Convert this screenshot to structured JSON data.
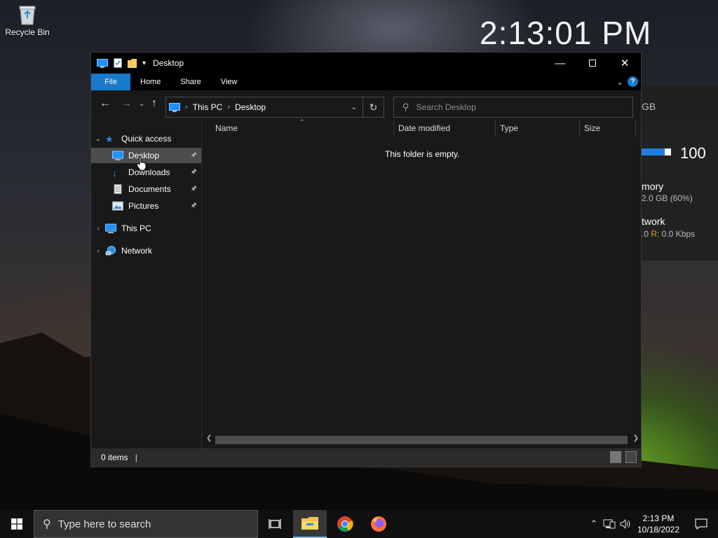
{
  "desktop": {
    "recycle_bin_label": "Recycle Bin"
  },
  "widget": {
    "clock": "2:13:01 PM",
    "disk_unit": "GB",
    "cpu_value": "100",
    "memory_title": "mory",
    "memory_value": "2.0 GB (60%)",
    "network_title": "twork",
    "network_value_prefix": ".0 ",
    "network_r_label": "R:",
    "network_value_suffix": " 0.0 Kbps"
  },
  "explorer": {
    "title": "Desktop",
    "ribbon_tabs": [
      "File",
      "Home",
      "Share",
      "View"
    ],
    "help_label": "?",
    "address": {
      "root": "This PC",
      "current": "Desktop"
    },
    "search_placeholder": "Search Desktop",
    "sidebar": {
      "quick_access": "Quick access",
      "items": [
        "Desktop",
        "Downloads",
        "Documents",
        "Pictures"
      ],
      "this_pc": "This PC",
      "network": "Network"
    },
    "columns": [
      "Name",
      "Date modified",
      "Type",
      "Size"
    ],
    "empty_message": "This folder is empty.",
    "status_items": "0 items"
  },
  "taskbar": {
    "search_placeholder": "Type here to search",
    "time": "2:13 PM",
    "date": "10/18/2022"
  },
  "colors": {
    "accent": "#1979ca",
    "window_bg": "#191919",
    "selected_bg": "#4d4d4d",
    "taskbar_bg": "#101010"
  }
}
